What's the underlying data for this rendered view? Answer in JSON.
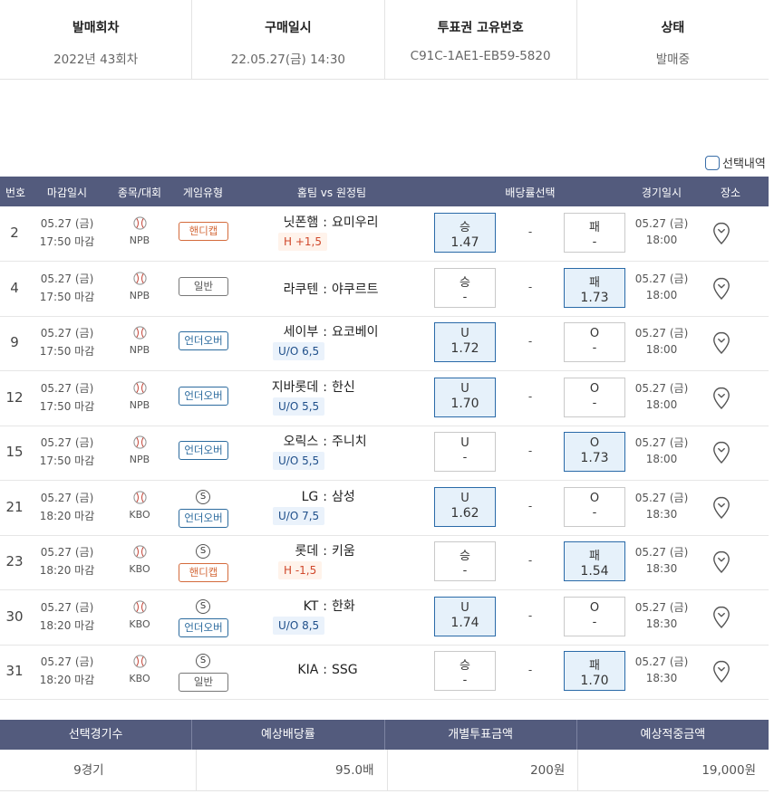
{
  "ticket": {
    "headers": [
      "발매회차",
      "구매일시",
      "투표권 고유번호",
      "상태"
    ],
    "values": [
      "2022년 43회차",
      "22.05.27(금) 14:30",
      "C91C-1AE1-EB59-5820",
      "발매중"
    ]
  },
  "select_history_label": "선택내역",
  "table": {
    "columns": [
      "번호",
      "마감일시",
      "종목/대회",
      "게임유형",
      "홈팀 vs 원정팀",
      "배당률선택",
      "경기일시",
      "장소"
    ],
    "rows": [
      {
        "no": "2",
        "close_date": "05.27 (금)",
        "close_time": "17:50 마감",
        "league": "NPB",
        "special": "",
        "game_type": "핸디캡",
        "type_style": "orange",
        "home": "닛폰햄",
        "away": "요미우리",
        "handicap": "H +1,5",
        "handi_style": "red",
        "left_label": "승",
        "left_odds": "1.47",
        "left_selected": true,
        "mid": "-",
        "right_label": "패",
        "right_odds": "-",
        "right_selected": false,
        "game_date": "05.27 (금)",
        "game_time": "18:00"
      },
      {
        "no": "4",
        "close_date": "05.27 (금)",
        "close_time": "17:50 마감",
        "league": "NPB",
        "special": "",
        "game_type": "일반",
        "type_style": "gray",
        "home": "라쿠텐",
        "away": "야쿠르트",
        "handicap": "",
        "handi_style": "",
        "left_label": "승",
        "left_odds": "-",
        "left_selected": false,
        "mid": "-",
        "right_label": "패",
        "right_odds": "1.73",
        "right_selected": true,
        "game_date": "05.27 (금)",
        "game_time": "18:00"
      },
      {
        "no": "9",
        "close_date": "05.27 (금)",
        "close_time": "17:50 마감",
        "league": "NPB",
        "special": "",
        "game_type": "언더오버",
        "type_style": "blue",
        "home": "세이부",
        "away": "요코베이",
        "handicap": "U/O 6,5",
        "handi_style": "blue",
        "left_label": "U",
        "left_odds": "1.72",
        "left_selected": true,
        "mid": "-",
        "right_label": "O",
        "right_odds": "-",
        "right_selected": false,
        "game_date": "05.27 (금)",
        "game_time": "18:00"
      },
      {
        "no": "12",
        "close_date": "05.27 (금)",
        "close_time": "17:50 마감",
        "league": "NPB",
        "special": "",
        "game_type": "언더오버",
        "type_style": "blue",
        "home": "지바롯데",
        "away": "한신",
        "handicap": "U/O 5,5",
        "handi_style": "blue",
        "left_label": "U",
        "left_odds": "1.70",
        "left_selected": true,
        "mid": "-",
        "right_label": "O",
        "right_odds": "-",
        "right_selected": false,
        "game_date": "05.27 (금)",
        "game_time": "18:00"
      },
      {
        "no": "15",
        "close_date": "05.27 (금)",
        "close_time": "17:50 마감",
        "league": "NPB",
        "special": "",
        "game_type": "언더오버",
        "type_style": "blue",
        "home": "오릭스",
        "away": "주니치",
        "handicap": "U/O 5,5",
        "handi_style": "blue",
        "left_label": "U",
        "left_odds": "-",
        "left_selected": false,
        "mid": "-",
        "right_label": "O",
        "right_odds": "1.73",
        "right_selected": true,
        "game_date": "05.27 (금)",
        "game_time": "18:00"
      },
      {
        "no": "21",
        "close_date": "05.27 (금)",
        "close_time": "18:20 마감",
        "league": "KBO",
        "special": "S",
        "game_type": "언더오버",
        "type_style": "blue",
        "home": "LG",
        "away": "삼성",
        "handicap": "U/O 7,5",
        "handi_style": "blue",
        "left_label": "U",
        "left_odds": "1.62",
        "left_selected": true,
        "mid": "-",
        "right_label": "O",
        "right_odds": "-",
        "right_selected": false,
        "game_date": "05.27 (금)",
        "game_time": "18:30"
      },
      {
        "no": "23",
        "close_date": "05.27 (금)",
        "close_time": "18:20 마감",
        "league": "KBO",
        "special": "S",
        "game_type": "핸디캡",
        "type_style": "orange",
        "home": "롯데",
        "away": "키움",
        "handicap": "H -1,5",
        "handi_style": "red",
        "left_label": "승",
        "left_odds": "-",
        "left_selected": false,
        "mid": "-",
        "right_label": "패",
        "right_odds": "1.54",
        "right_selected": true,
        "game_date": "05.27 (금)",
        "game_time": "18:30"
      },
      {
        "no": "30",
        "close_date": "05.27 (금)",
        "close_time": "18:20 마감",
        "league": "KBO",
        "special": "S",
        "game_type": "언더오버",
        "type_style": "blue",
        "home": "KT",
        "away": "한화",
        "handicap": "U/O 8,5",
        "handi_style": "blue",
        "left_label": "U",
        "left_odds": "1.74",
        "left_selected": true,
        "mid": "-",
        "right_label": "O",
        "right_odds": "-",
        "right_selected": false,
        "game_date": "05.27 (금)",
        "game_time": "18:30"
      },
      {
        "no": "31",
        "close_date": "05.27 (금)",
        "close_time": "18:20 마감",
        "league": "KBO",
        "special": "S",
        "game_type": "일반",
        "type_style": "gray",
        "home": "KIA",
        "away": "SSG",
        "handicap": "",
        "handi_style": "",
        "left_label": "승",
        "left_odds": "-",
        "left_selected": false,
        "mid": "-",
        "right_label": "패",
        "right_odds": "1.70",
        "right_selected": true,
        "game_date": "05.27 (금)",
        "game_time": "18:30"
      }
    ]
  },
  "summary": {
    "headers": [
      "선택경기수",
      "예상배당률",
      "개별투표금액",
      "예상적중금액"
    ],
    "values": [
      "9경기",
      "95.0배",
      "200원",
      "19,000원"
    ]
  }
}
